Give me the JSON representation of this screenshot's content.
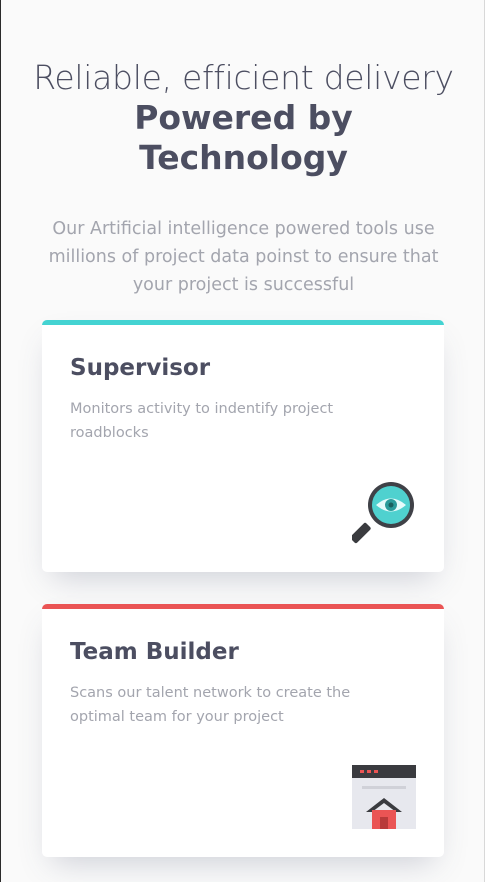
{
  "header": {
    "headline_light": "Reliable, efficient delivery",
    "headline_bold": "Powered by Technology",
    "subtitle": "Our Artificial intelligence powered tools use millions of project data poinst to ensure that your project is successful"
  },
  "cards": [
    {
      "title": "Supervisor",
      "description": "Monitors activity to indentify project roadblocks",
      "accent": "#44d3d2",
      "icon": "magnifier-eye-icon"
    },
    {
      "title": "Team Builder",
      "description": "Scans our talent network to create the optimal team for your project",
      "accent": "#ea5454",
      "icon": "team-builder-icon"
    }
  ]
}
